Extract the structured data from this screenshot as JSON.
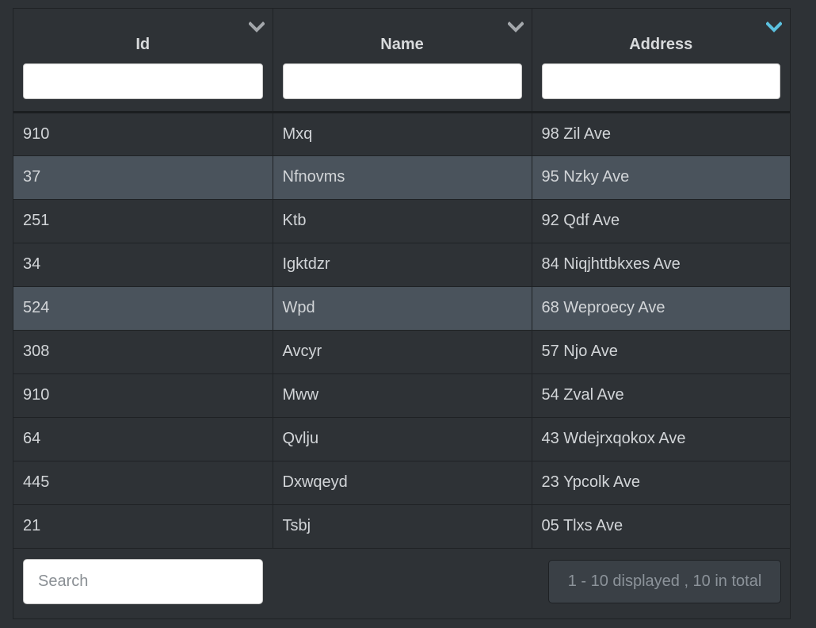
{
  "columns": [
    {
      "label": "Id",
      "sort_icon": "chevron-down-icon",
      "sort_color": "#a3a7ab"
    },
    {
      "label": "Name",
      "sort_icon": "chevron-down-icon",
      "sort_color": "#a3a7ab"
    },
    {
      "label": "Address",
      "sort_icon": "chevron-down-icon",
      "sort_color": "#5bc0de"
    }
  ],
  "rows": [
    {
      "id": "910",
      "name": "Mxq",
      "address": "98 Zil Ave",
      "highlighted": false
    },
    {
      "id": "37",
      "name": "Nfnovms",
      "address": "95 Nzky Ave",
      "highlighted": true
    },
    {
      "id": "251",
      "name": "Ktb",
      "address": "92 Qdf Ave",
      "highlighted": false
    },
    {
      "id": "34",
      "name": "Igktdzr",
      "address": "84 Niqjhttbkxes Ave",
      "highlighted": false
    },
    {
      "id": "524",
      "name": "Wpd",
      "address": "68 Weproecy Ave",
      "highlighted": true
    },
    {
      "id": "308",
      "name": "Avcyr",
      "address": "57 Njo Ave",
      "highlighted": false
    },
    {
      "id": "910",
      "name": "Mww",
      "address": "54 Zval Ave",
      "highlighted": false
    },
    {
      "id": "64",
      "name": "Qvlju",
      "address": "43 Wdejrxqokox Ave",
      "highlighted": false
    },
    {
      "id": "445",
      "name": "Dxwqeyd",
      "address": "23 Ypcolk Ave",
      "highlighted": false
    },
    {
      "id": "21",
      "name": "Tsbj",
      "address": "05 Tlxs Ave",
      "highlighted": false
    }
  ],
  "footer": {
    "search_placeholder": "Search",
    "status_text": "1 - 10 displayed , 10 in total"
  },
  "colors": {
    "background": "#2e3236",
    "row_highlight": "#4a535c",
    "sort_active": "#5bc0de"
  }
}
